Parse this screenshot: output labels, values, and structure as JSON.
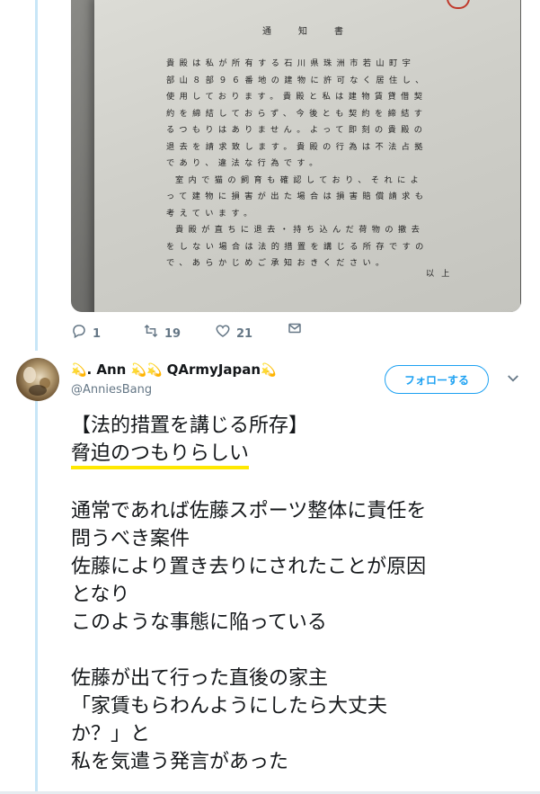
{
  "photo_document": {
    "title": "通　知　書",
    "lines": [
      "貴殿は私が所有する石川県珠洲市若山町宇",
      "部山８部９６番地の建物に許可なく居住し、",
      "使用しております。貴殿と私は建物賃貸借契",
      "約を締結しておらず、今後とも契約を締結す",
      "るつもりはありません。よって即刻の貴殿の",
      "退去を請求致します。貴殿の行為は不法占拠",
      "であり、違法な行為です。",
      "室内で猫の飼育も確認しており、それによ",
      "って建物に損害が出た場合は損害賠償請求も",
      "考えています。",
      "貴殿が直ちに退去・持ち込んだ荷物の撤去",
      "をしない場合は法的措置を講じる所存ですの",
      "で、あらかじめご承知おきください。"
    ],
    "ending": "以上"
  },
  "actions": {
    "reply_count": "1",
    "retweet_count": "19",
    "like_count": "21"
  },
  "tweet": {
    "display_name_part1": ". Ann",
    "display_name_part2": "QArmyJapan",
    "handle": "@AnniesBang",
    "follow_label": "フォローする",
    "body": {
      "heading": "【法的措置を講じる所存】",
      "highlight": "脅迫のつもりらしい",
      "para2": [
        "通常であれば佐藤スポーツ整体に責任を",
        "問うべき案件",
        "佐藤により置き去りにされたことが原因",
        "となり",
        "このような事態に陥っている"
      ],
      "para3": [
        "佐藤が出て行った直後の家主",
        "「家賃もらわんようにしたら大丈夫",
        "か？」と",
        "私を気遣う発言があった"
      ]
    }
  },
  "colors": {
    "accent": "#1da1f2",
    "muted": "#657786",
    "highlight": "#ffe800",
    "thread": "#c8e6f7"
  },
  "icons": [
    "reply-icon",
    "retweet-icon",
    "like-icon",
    "dm-icon",
    "chevron-down-icon",
    "star-emoji"
  ]
}
